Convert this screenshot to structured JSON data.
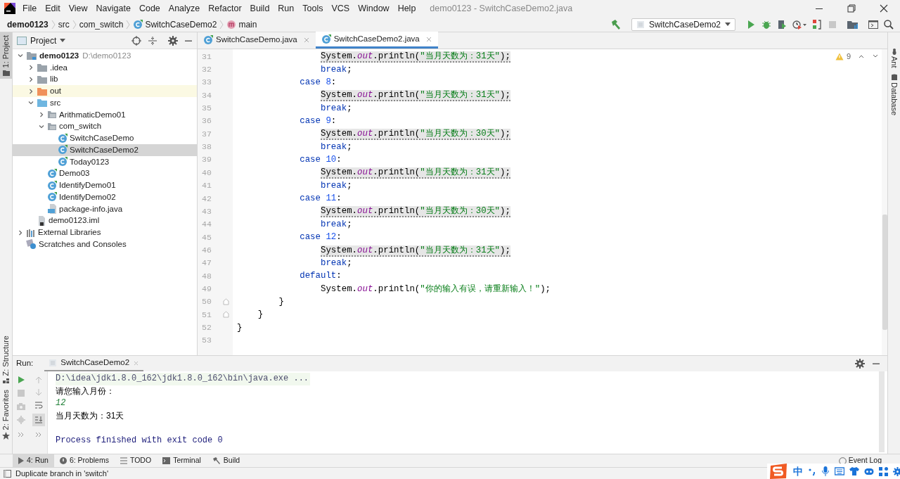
{
  "window": {
    "title": "demo0123 - SwitchCaseDemo2.java"
  },
  "menu": [
    "File",
    "Edit",
    "View",
    "Navigate",
    "Code",
    "Analyze",
    "Refactor",
    "Build",
    "Run",
    "Tools",
    "VCS",
    "Window",
    "Help"
  ],
  "breadcrumb": [
    {
      "kind": "project",
      "label": "demo0123"
    },
    {
      "kind": "folder",
      "label": "src"
    },
    {
      "kind": "folder",
      "label": "com_switch"
    },
    {
      "kind": "class",
      "label": "SwitchCaseDemo2"
    },
    {
      "kind": "method",
      "label": "main"
    }
  ],
  "run_config": "SwitchCaseDemo2",
  "left_tool_strip": [
    {
      "label": "1: Project",
      "selected": true
    },
    {
      "label": "Z: Structure",
      "selected": false
    },
    {
      "label": "2: Favorites",
      "selected": false
    }
  ],
  "right_tool_strip": [
    "Ant",
    "Database"
  ],
  "project_panel": {
    "title": "Project",
    "tree": [
      {
        "kind": "project",
        "label": "demo0123",
        "path": "D:\\demo0123",
        "expanded": true,
        "selected": false,
        "children": [
          {
            "kind": "folder",
            "label": ".idea",
            "expanded": false,
            "selected": false
          },
          {
            "kind": "folder",
            "label": "lib",
            "expanded": false,
            "selected": false
          },
          {
            "kind": "excluded-folder",
            "label": "out",
            "expanded": false,
            "selected": false
          },
          {
            "kind": "source-folder",
            "label": "src",
            "expanded": true,
            "selected": false,
            "children": [
              {
                "kind": "package",
                "label": "ArithmaticDemo01",
                "expanded": false,
                "selected": false
              },
              {
                "kind": "package",
                "label": "com_switch",
                "expanded": true,
                "selected": false,
                "children": [
                  {
                    "kind": "class",
                    "label": "SwitchCaseDemo",
                    "selected": false
                  },
                  {
                    "kind": "class",
                    "label": "SwitchCaseDemo2",
                    "selected": true
                  },
                  {
                    "kind": "class",
                    "label": "Today0123",
                    "selected": false
                  }
                ]
              },
              {
                "kind": "class",
                "label": "Demo03",
                "selected": false
              },
              {
                "kind": "class",
                "label": "IdentifyDemo01",
                "selected": false
              },
              {
                "kind": "class",
                "label": "IdentifyDemo02",
                "selected": false
              },
              {
                "kind": "java-file",
                "label": "package-info.java",
                "selected": false
              }
            ]
          },
          {
            "kind": "module-file",
            "label": "demo0123.iml",
            "selected": false
          }
        ]
      },
      {
        "kind": "libraries",
        "label": "External Libraries",
        "expanded": false,
        "selected": false
      },
      {
        "kind": "scratches",
        "label": "Scratches and Consoles",
        "selected": false
      }
    ]
  },
  "editor_tabs": [
    {
      "label": "SwitchCaseDemo.java",
      "selected": false
    },
    {
      "label": "SwitchCaseDemo2.java",
      "selected": true
    }
  ],
  "warning_count": "9",
  "code_lines": [
    {
      "number": "31",
      "warning": true,
      "fold": false,
      "segments": [
        {
          "kind": "plain",
          "text": "                System."
        },
        {
          "kind": "field",
          "text": "out"
        },
        {
          "kind": "plain",
          "text": ".println("
        },
        {
          "kind": "string",
          "text": "\"当月天数为：31天\""
        },
        {
          "kind": "plain",
          "text": ");"
        }
      ]
    },
    {
      "number": "32",
      "warning": false,
      "fold": false,
      "segments": [
        {
          "kind": "keyword",
          "text": "                break"
        },
        {
          "kind": "plain",
          "text": ";"
        }
      ]
    },
    {
      "number": "33",
      "warning": false,
      "fold": false,
      "segments": [
        {
          "kind": "keyword",
          "text": "            case "
        },
        {
          "kind": "number",
          "text": "8"
        },
        {
          "kind": "plain",
          "text": ":"
        }
      ]
    },
    {
      "number": "34",
      "warning": true,
      "fold": false,
      "segments": [
        {
          "kind": "plain",
          "text": "                System."
        },
        {
          "kind": "field",
          "text": "out"
        },
        {
          "kind": "plain",
          "text": ".println("
        },
        {
          "kind": "string",
          "text": "\"当月天数为：31天\""
        },
        {
          "kind": "plain",
          "text": ");"
        }
      ]
    },
    {
      "number": "35",
      "warning": false,
      "fold": false,
      "segments": [
        {
          "kind": "keyword",
          "text": "                break"
        },
        {
          "kind": "plain",
          "text": ";"
        }
      ]
    },
    {
      "number": "36",
      "warning": false,
      "fold": false,
      "segments": [
        {
          "kind": "keyword",
          "text": "            case "
        },
        {
          "kind": "number",
          "text": "9"
        },
        {
          "kind": "plain",
          "text": ":"
        }
      ]
    },
    {
      "number": "37",
      "warning": true,
      "fold": false,
      "segments": [
        {
          "kind": "plain",
          "text": "                System."
        },
        {
          "kind": "field",
          "text": "out"
        },
        {
          "kind": "plain",
          "text": ".println("
        },
        {
          "kind": "string",
          "text": "\"当月天数为：30天\""
        },
        {
          "kind": "plain",
          "text": ");"
        }
      ]
    },
    {
      "number": "38",
      "warning": false,
      "fold": false,
      "segments": [
        {
          "kind": "keyword",
          "text": "                break"
        },
        {
          "kind": "plain",
          "text": ";"
        }
      ]
    },
    {
      "number": "39",
      "warning": false,
      "fold": false,
      "segments": [
        {
          "kind": "keyword",
          "text": "            case "
        },
        {
          "kind": "number",
          "text": "10"
        },
        {
          "kind": "plain",
          "text": ":"
        }
      ]
    },
    {
      "number": "40",
      "warning": true,
      "fold": false,
      "segments": [
        {
          "kind": "plain",
          "text": "                System."
        },
        {
          "kind": "field",
          "text": "out"
        },
        {
          "kind": "plain",
          "text": ".println("
        },
        {
          "kind": "string",
          "text": "\"当月天数为：31天\""
        },
        {
          "kind": "plain",
          "text": ");"
        }
      ]
    },
    {
      "number": "41",
      "warning": false,
      "fold": false,
      "segments": [
        {
          "kind": "keyword",
          "text": "                break"
        },
        {
          "kind": "plain",
          "text": ";"
        }
      ]
    },
    {
      "number": "42",
      "warning": false,
      "fold": false,
      "segments": [
        {
          "kind": "keyword",
          "text": "            case "
        },
        {
          "kind": "number",
          "text": "11"
        },
        {
          "kind": "plain",
          "text": ":"
        }
      ]
    },
    {
      "number": "43",
      "warning": true,
      "fold": false,
      "segments": [
        {
          "kind": "plain",
          "text": "                System."
        },
        {
          "kind": "field",
          "text": "out"
        },
        {
          "kind": "plain",
          "text": ".println("
        },
        {
          "kind": "string",
          "text": "\"当月天数为：30天\""
        },
        {
          "kind": "plain",
          "text": ");"
        }
      ]
    },
    {
      "number": "44",
      "warning": false,
      "fold": false,
      "segments": [
        {
          "kind": "keyword",
          "text": "                break"
        },
        {
          "kind": "plain",
          "text": ";"
        }
      ]
    },
    {
      "number": "45",
      "warning": false,
      "fold": false,
      "segments": [
        {
          "kind": "keyword",
          "text": "            case "
        },
        {
          "kind": "number",
          "text": "12"
        },
        {
          "kind": "plain",
          "text": ":"
        }
      ]
    },
    {
      "number": "46",
      "warning": true,
      "fold": false,
      "segments": [
        {
          "kind": "plain",
          "text": "                System."
        },
        {
          "kind": "field",
          "text": "out"
        },
        {
          "kind": "plain",
          "text": ".println("
        },
        {
          "kind": "string",
          "text": "\"当月天数为：31天\""
        },
        {
          "kind": "plain",
          "text": ");"
        }
      ]
    },
    {
      "number": "47",
      "warning": false,
      "fold": false,
      "segments": [
        {
          "kind": "keyword",
          "text": "                break"
        },
        {
          "kind": "plain",
          "text": ";"
        }
      ]
    },
    {
      "number": "48",
      "warning": false,
      "fold": false,
      "segments": [
        {
          "kind": "keyword",
          "text": "            default"
        },
        {
          "kind": "plain",
          "text": ":"
        }
      ]
    },
    {
      "number": "49",
      "warning": false,
      "fold": false,
      "segments": [
        {
          "kind": "plain",
          "text": "                System."
        },
        {
          "kind": "field",
          "text": "out"
        },
        {
          "kind": "plain",
          "text": ".println("
        },
        {
          "kind": "string",
          "text": "\"你的输入有误，请重新输入！\""
        },
        {
          "kind": "plain",
          "text": ");"
        }
      ]
    },
    {
      "number": "50",
      "warning": false,
      "fold": true,
      "segments": [
        {
          "kind": "plain",
          "text": "        }"
        }
      ]
    },
    {
      "number": "51",
      "warning": false,
      "fold": true,
      "segments": [
        {
          "kind": "plain",
          "text": "    }"
        }
      ]
    },
    {
      "number": "52",
      "warning": false,
      "fold": false,
      "segments": [
        {
          "kind": "plain",
          "text": "}"
        }
      ]
    },
    {
      "number": "53",
      "fold": false
    }
  ],
  "run_panel": {
    "title": "Run:",
    "tab": "SwitchCaseDemo2",
    "console": [
      {
        "kind": "command",
        "text": "D:\\idea\\jdk1.8.0_162\\jdk1.8.0_162\\bin\\java.exe ..."
      },
      {
        "kind": "output",
        "text": "请您输入月份："
      },
      {
        "kind": "input",
        "text": "12"
      },
      {
        "kind": "output",
        "text": "当月天数为：31天"
      },
      {
        "kind": "exit",
        "text": "Process finished with exit code 0"
      }
    ]
  },
  "bottom_tabs": [
    {
      "label": "4: Run",
      "selected": true
    },
    {
      "label": "6: Problems",
      "selected": false
    },
    {
      "label": "TODO",
      "selected": false
    },
    {
      "label": "Terminal",
      "selected": false
    },
    {
      "label": "Build",
      "selected": false
    }
  ],
  "event_log": "Event Log",
  "status_bar": {
    "message": "Duplicate branch in 'switch'"
  },
  "ime_toolbar": {
    "mode": "中"
  }
}
